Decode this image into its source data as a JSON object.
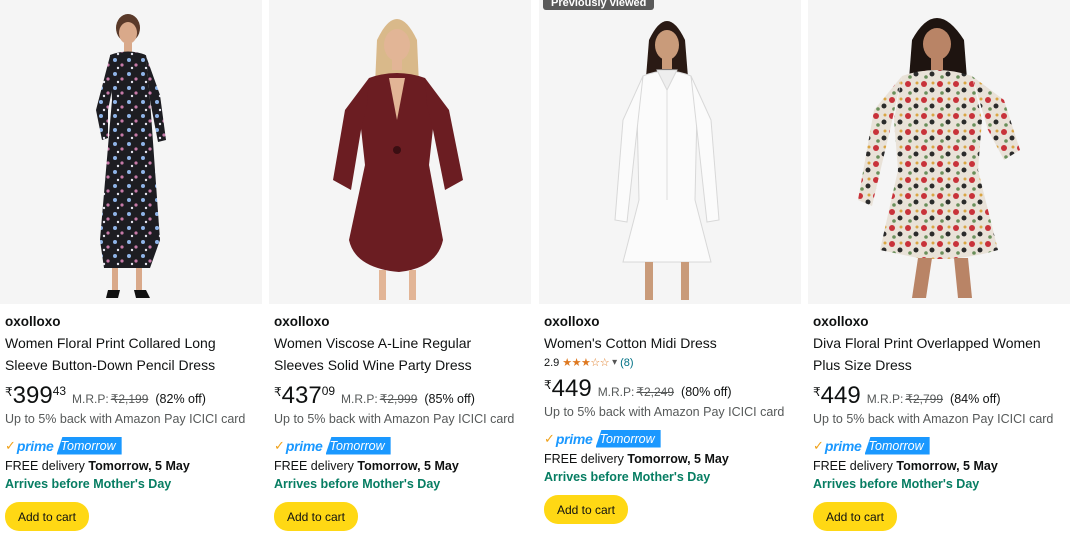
{
  "badge": "Previously viewed",
  "products": [
    {
      "brand": "oxolloxo",
      "title_line1": "Women Floral Print Collared Long",
      "title_line2": "Sleeve Button-Down Pencil Dress",
      "currency": "₹",
      "price_whole": "399",
      "price_fraction": "43",
      "mrp_label": "M.R.P:",
      "mrp": "₹2,199",
      "discount": "(82% off)",
      "cashback": "Up to 5% back with Amazon Pay ICICI card",
      "prime_label": "prime",
      "prime_tag": "Tomorrow",
      "delivery_prefix": "FREE delivery",
      "delivery_date": "Tomorrow, 5 May",
      "arrives": "Arrives before Mother's Day",
      "add_to_cart": "Add to cart",
      "image": "woman-black-floral-dress-image"
    },
    {
      "brand": "oxolloxo",
      "title_line1": "Women Viscose A-Line Regular",
      "title_line2": "Sleeves Solid Wine Party Dress",
      "currency": "₹",
      "price_whole": "437",
      "price_fraction": "09",
      "mrp_label": "M.R.P:",
      "mrp": "₹2,999",
      "discount": "(85% off)",
      "cashback": "Up to 5% back with Amazon Pay ICICI card",
      "prime_label": "prime",
      "prime_tag": "Tomorrow",
      "delivery_prefix": "FREE delivery",
      "delivery_date": "Tomorrow, 5 May",
      "arrives": "Arrives before Mother's Day",
      "add_to_cart": "Add to cart",
      "image": "woman-wine-dress-image"
    },
    {
      "brand": "oxolloxo",
      "title_line1": "Women's Cotton Midi Dress",
      "rating": "2.9",
      "rating_value": 2.9,
      "rating_count": "(8)",
      "currency": "₹",
      "price_whole": "449",
      "price_fraction": "",
      "mrp_label": "M.R.P:",
      "mrp": "₹2,249",
      "discount": "(80% off)",
      "cashback": "Up to 5% back with Amazon Pay ICICI card",
      "prime_label": "prime",
      "prime_tag": "Tomorrow",
      "delivery_prefix": "FREE delivery",
      "delivery_date": "Tomorrow, 5 May",
      "arrives": "Arrives before Mother's Day",
      "add_to_cart": "Add to cart",
      "image": "woman-white-shirt-dress-image"
    },
    {
      "brand": "oxolloxo",
      "title_line1": "Diva Floral Print Overlapped Women",
      "title_line2": "Plus Size Dress",
      "currency": "₹",
      "price_whole": "449",
      "price_fraction": "",
      "mrp_label": "M.R.P:",
      "mrp": "₹2,799",
      "discount": "(84% off)",
      "cashback": "Up to 5% back with Amazon Pay ICICI card",
      "prime_label": "prime",
      "prime_tag": "Tomorrow",
      "delivery_prefix": "FREE delivery",
      "delivery_date": "Tomorrow, 5 May",
      "arrives": "Arrives before Mother's Day",
      "add_to_cart": "Add to cart",
      "image": "woman-red-floral-wrap-dress-image"
    }
  ],
  "colors": {
    "prime_blue": "#1a98ff",
    "arrives_green": "#067d62",
    "cart_yellow": "#ffd814",
    "star_orange": "#de7921"
  }
}
